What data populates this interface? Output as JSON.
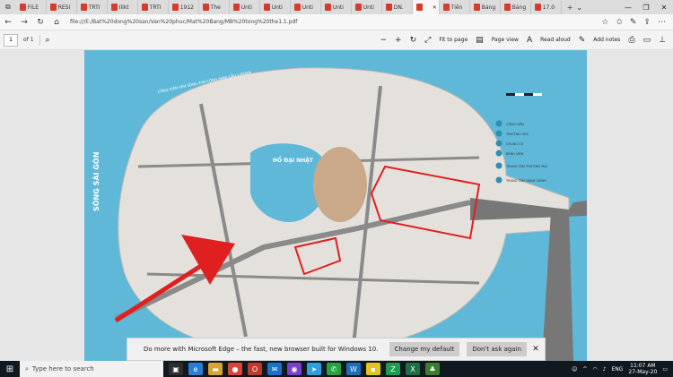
{
  "tabs": [
    {
      "label": "FILE"
    },
    {
      "label": "RESI"
    },
    {
      "label": "TRTI"
    },
    {
      "label": "Ilikt"
    },
    {
      "label": "TRTI"
    },
    {
      "label": "1912"
    },
    {
      "label": "The"
    },
    {
      "label": "Unti"
    },
    {
      "label": "Unti"
    },
    {
      "label": "Unti"
    },
    {
      "label": "Unti"
    },
    {
      "label": "Unti"
    },
    {
      "label": "DN."
    },
    {
      "label": ""
    },
    {
      "label": "Tiền"
    },
    {
      "label": "Bảng"
    },
    {
      "label": "Bảng"
    },
    {
      "label": "17.0"
    }
  ],
  "address": {
    "url": "file:///E:/Bat%20dong%20san/Van%20phuc/Mat%20Bang/MB%20tong%20the1.1.pdf"
  },
  "pdf_toolbar": {
    "page_number": "1",
    "page_count": "of 1",
    "fit_to_page": "Fit to page",
    "page_view": "Page view",
    "read_aloud": "Read aloud",
    "add_notes": "Add notes"
  },
  "map": {
    "river_label": "SÔNG SÀI GÒN",
    "lake_label": "HỒ ĐẠI NHẬT",
    "road_label": "CÔNG VIÊN VEN SÔNG THE CÔNG PARK CẦU 1 ĐOẠN",
    "legend": [
      {
        "label": "CÔNG VIÊN",
        "color": "#2b8fb3"
      },
      {
        "label": "TRƯỜNG HỌC",
        "color": "#2b8fb3"
      },
      {
        "label": "CHUNG CƯ",
        "color": "#2b8fb3"
      },
      {
        "label": "BỆNH VIỆN",
        "color": "#2b8fb3"
      },
      {
        "label": "TRUNG TÂM THƯƠNG MẠI",
        "color": "#2b8fb3"
      },
      {
        "label": "TRUNG TÂM HÀNH CHÍNH",
        "color": "#2b8fb3"
      }
    ]
  },
  "banner": {
    "message": "Do more with Microsoft Edge – the fast, new browser built for Windows 10.",
    "primary": "Change my default",
    "secondary": "Don't ask again"
  },
  "taskbar": {
    "search_placeholder": "Type here to search",
    "lang": "ENG",
    "time": "11:07 AM",
    "date": "27-May-20"
  },
  "colors": {
    "water": "#5fb8d8",
    "highlight": "#e02020",
    "road": "#8a8a8a"
  }
}
